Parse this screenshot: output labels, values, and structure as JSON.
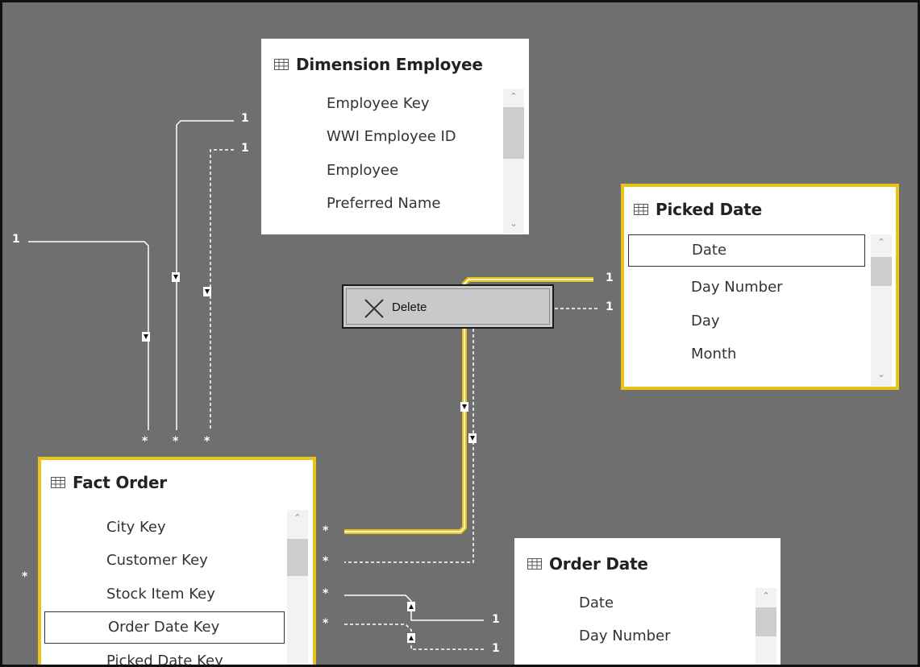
{
  "tables": {
    "dimension_employee": {
      "title": "Dimension Employee",
      "fields": [
        "Employee Key",
        "WWI Employee ID",
        "Employee",
        "Preferred Name"
      ]
    },
    "picked_date": {
      "title": "Picked Date",
      "fields": [
        "Date",
        "Day Number",
        "Day",
        "Month"
      ]
    },
    "fact_order": {
      "title": "Fact Order",
      "fields": [
        "City Key",
        "Customer Key",
        "Stock Item Key",
        "Order Date Key",
        "Picked Date Key"
      ]
    },
    "order_date": {
      "title": "Order Date",
      "fields": [
        "Date",
        "Day Number"
      ]
    }
  },
  "context_menu": {
    "delete_label": "Delete",
    "icon": "close-x-icon"
  },
  "cardinality": {
    "one": "1",
    "many": "*"
  },
  "colors": {
    "canvas": "#6f6f6f",
    "selection": "#e8c31c",
    "line": "#ffffff"
  }
}
